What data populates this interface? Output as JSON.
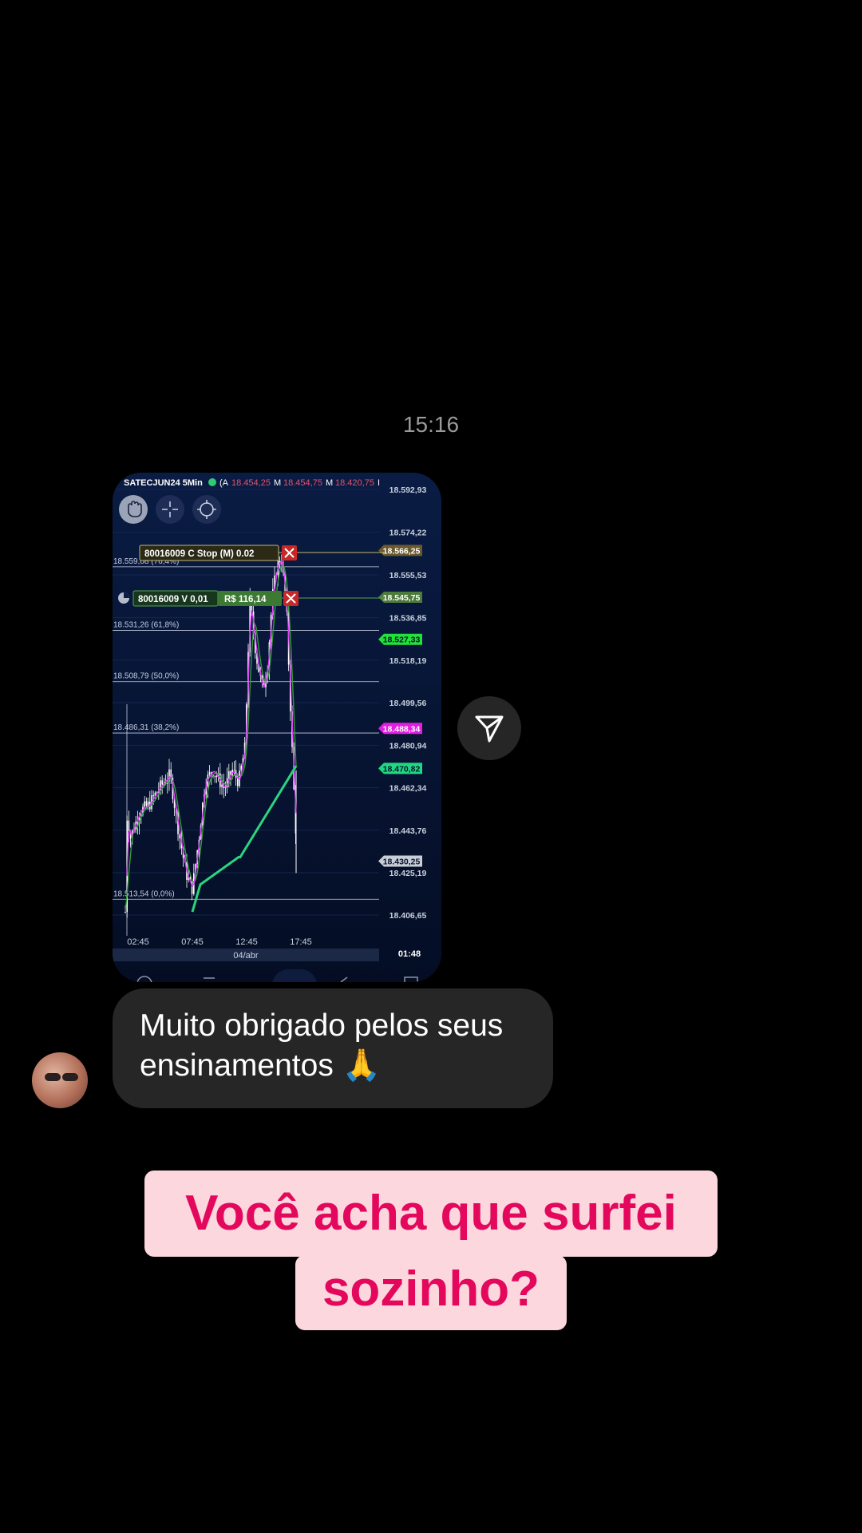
{
  "timestamp": "15:16",
  "shared_screenshot": {
    "header": {
      "symbol": "SATECJUN24 5Min",
      "prefix": "(A",
      "values": [
        "18.454,25",
        "M",
        "18.454,75",
        "M",
        "18.420,75",
        "I"
      ]
    },
    "price_axis": [
      "18.592,93",
      "18.574,22",
      "18.555,53",
      "18.536,85",
      "18.518,19",
      "18.499,56",
      "18.480,94",
      "18.462,34",
      "18.443,76",
      "18.425,19",
      "18.406,65"
    ],
    "fib_levels": [
      "18.559,08 (76,4%)",
      "18.531,26 (61,8%)",
      "18.508,79 (50,0%)",
      "18.486,31 (38,2%)",
      "18.513,54 (0,0%)"
    ],
    "price_tags": [
      {
        "text": "18.566,25",
        "color": "#6b5a2e"
      },
      {
        "text": "18.545,75",
        "color": "#4e7a3c"
      },
      {
        "text": "18.527,33",
        "color": "#22e23a"
      },
      {
        "text": "18.488,34",
        "color": "#e21ee0"
      },
      {
        "text": "18.470,82",
        "color": "#20d882"
      },
      {
        "text": "18.430,25",
        "color": "#c9cdd6"
      }
    ],
    "orders": [
      {
        "label": "80016009   C Stop (M)  0.02"
      },
      {
        "label": "80016009  V 0,01",
        "pnl": "R$ 116,14"
      }
    ],
    "time_axis": [
      "02:45",
      "07:45",
      "12:45",
      "17:45"
    ],
    "date_label": "04/abr",
    "countdown": "01:48",
    "colors": {
      "background": "#061232",
      "candles": "#ffffff",
      "fast_ma": "#e040fb",
      "slow_ma": "#2e9e38",
      "long_ma": "#2ad580"
    }
  },
  "message": {
    "text": "Muito obrigado pelos seus ensinamentos 🙏"
  },
  "caption": {
    "line1": "Você acha que surfei",
    "line2": "sozinho?"
  },
  "icons": {
    "share": "send-icon",
    "avatar": "user-avatar"
  }
}
